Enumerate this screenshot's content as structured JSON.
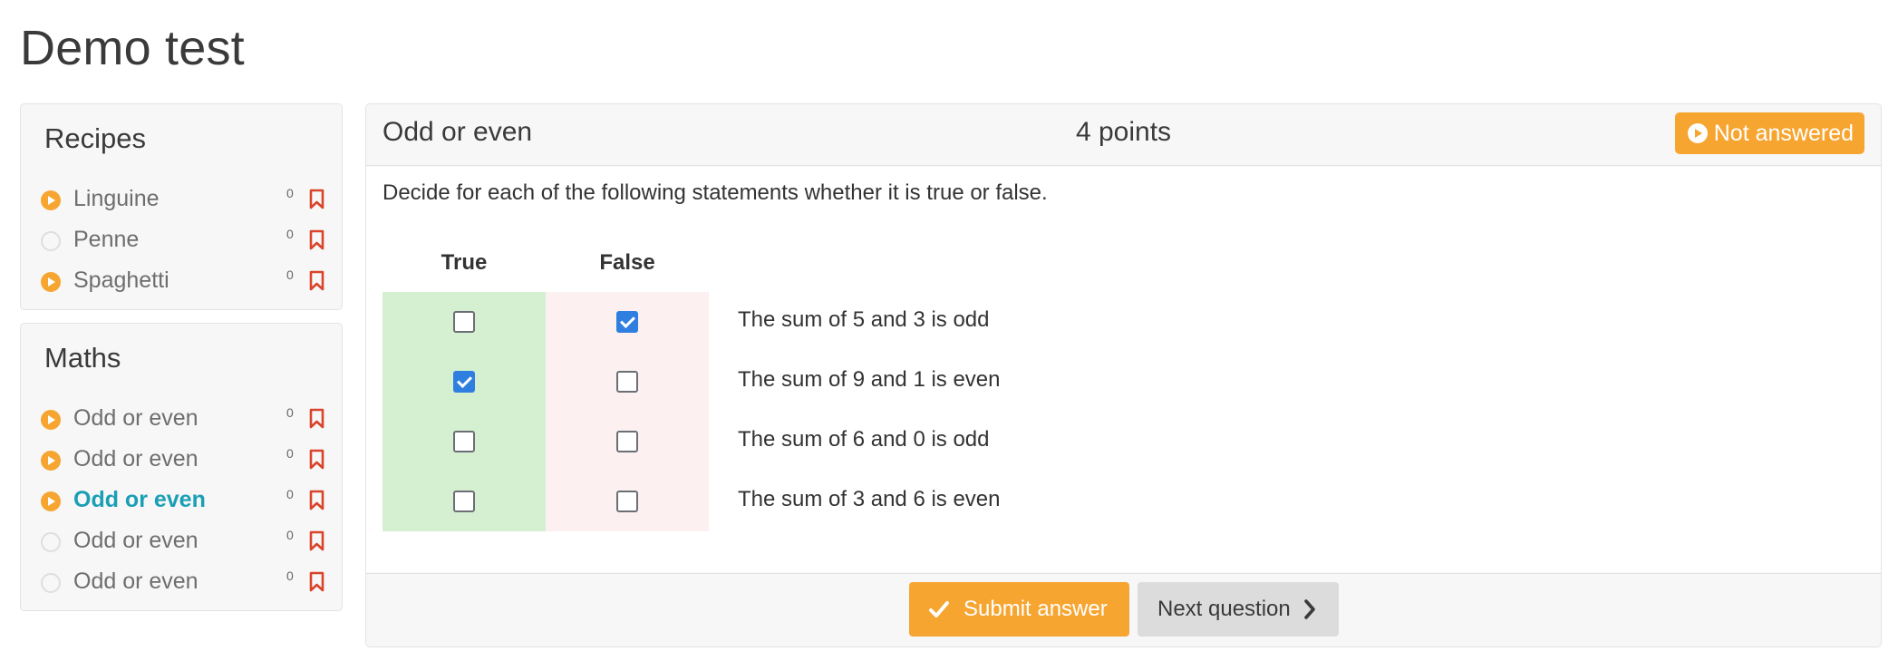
{
  "page": {
    "title": "Demo test"
  },
  "sidebar": {
    "sections": [
      {
        "heading": "Recipes",
        "items": [
          {
            "label": "Linguine",
            "count": "0",
            "status": "started",
            "active": false
          },
          {
            "label": "Penne",
            "count": "0",
            "status": "empty",
            "active": false
          },
          {
            "label": "Spaghetti",
            "count": "0",
            "status": "started",
            "active": false
          }
        ]
      },
      {
        "heading": "Maths",
        "items": [
          {
            "label": "Odd or even",
            "count": "0",
            "status": "started",
            "active": false
          },
          {
            "label": "Odd or even",
            "count": "0",
            "status": "started",
            "active": false
          },
          {
            "label": "Odd or even",
            "count": "0",
            "status": "started",
            "active": true
          },
          {
            "label": "Odd or even",
            "count": "0",
            "status": "empty",
            "active": false
          },
          {
            "label": "Odd or even",
            "count": "0",
            "status": "empty",
            "active": false
          }
        ]
      }
    ]
  },
  "question": {
    "title": "Odd or even",
    "points": "4 points",
    "status": "Not answered",
    "instructions": "Decide for each of the following statements whether it is true or false.",
    "column_true": "True",
    "column_false": "False",
    "rows": [
      {
        "statement": "The sum of 5 and 3 is odd",
        "answer": "false"
      },
      {
        "statement": "The sum of 9 and 1 is even",
        "answer": "true"
      },
      {
        "statement": "The sum of 6 and 0 is odd",
        "answer": "none"
      },
      {
        "statement": "The sum of 3 and 6 is even",
        "answer": "none"
      }
    ]
  },
  "footer": {
    "submit_label": "Submit answer",
    "next_label": "Next question"
  },
  "colors": {
    "accent": "#f7a531",
    "active_link": "#1a9fb5",
    "flag": "#d9442b",
    "checkbox_checked": "#2f7fe0",
    "true_column": "#d4f0d1",
    "false_column": "#fcf0f1"
  },
  "icons": {
    "item_status": "play-circle-icon",
    "bookmark": "bookmark-flag-icon",
    "submit": "check-icon",
    "next": "chevron-right-icon"
  }
}
